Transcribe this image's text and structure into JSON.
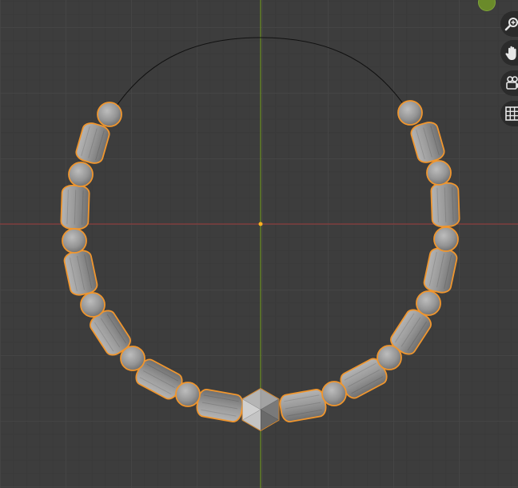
{
  "viewport": {
    "background_color": "#3d3d3d",
    "x_axis_color": "#9a3b3b",
    "y_axis_color": "#6b8f22",
    "selection_outline_color": "#f0962e",
    "bead_color": "#9a9a9a",
    "origin_color": "#ffb020"
  },
  "navigation_gizmos": [
    {
      "icon": "zoom-icon",
      "tooltip": ""
    },
    {
      "icon": "hand-pan-icon",
      "tooltip": ""
    },
    {
      "icon": "camera-icon",
      "tooltip": ""
    },
    {
      "icon": "grid-ortho-icon",
      "tooltip": ""
    }
  ],
  "axis_gizmo": {
    "color": "#6b8f22"
  }
}
